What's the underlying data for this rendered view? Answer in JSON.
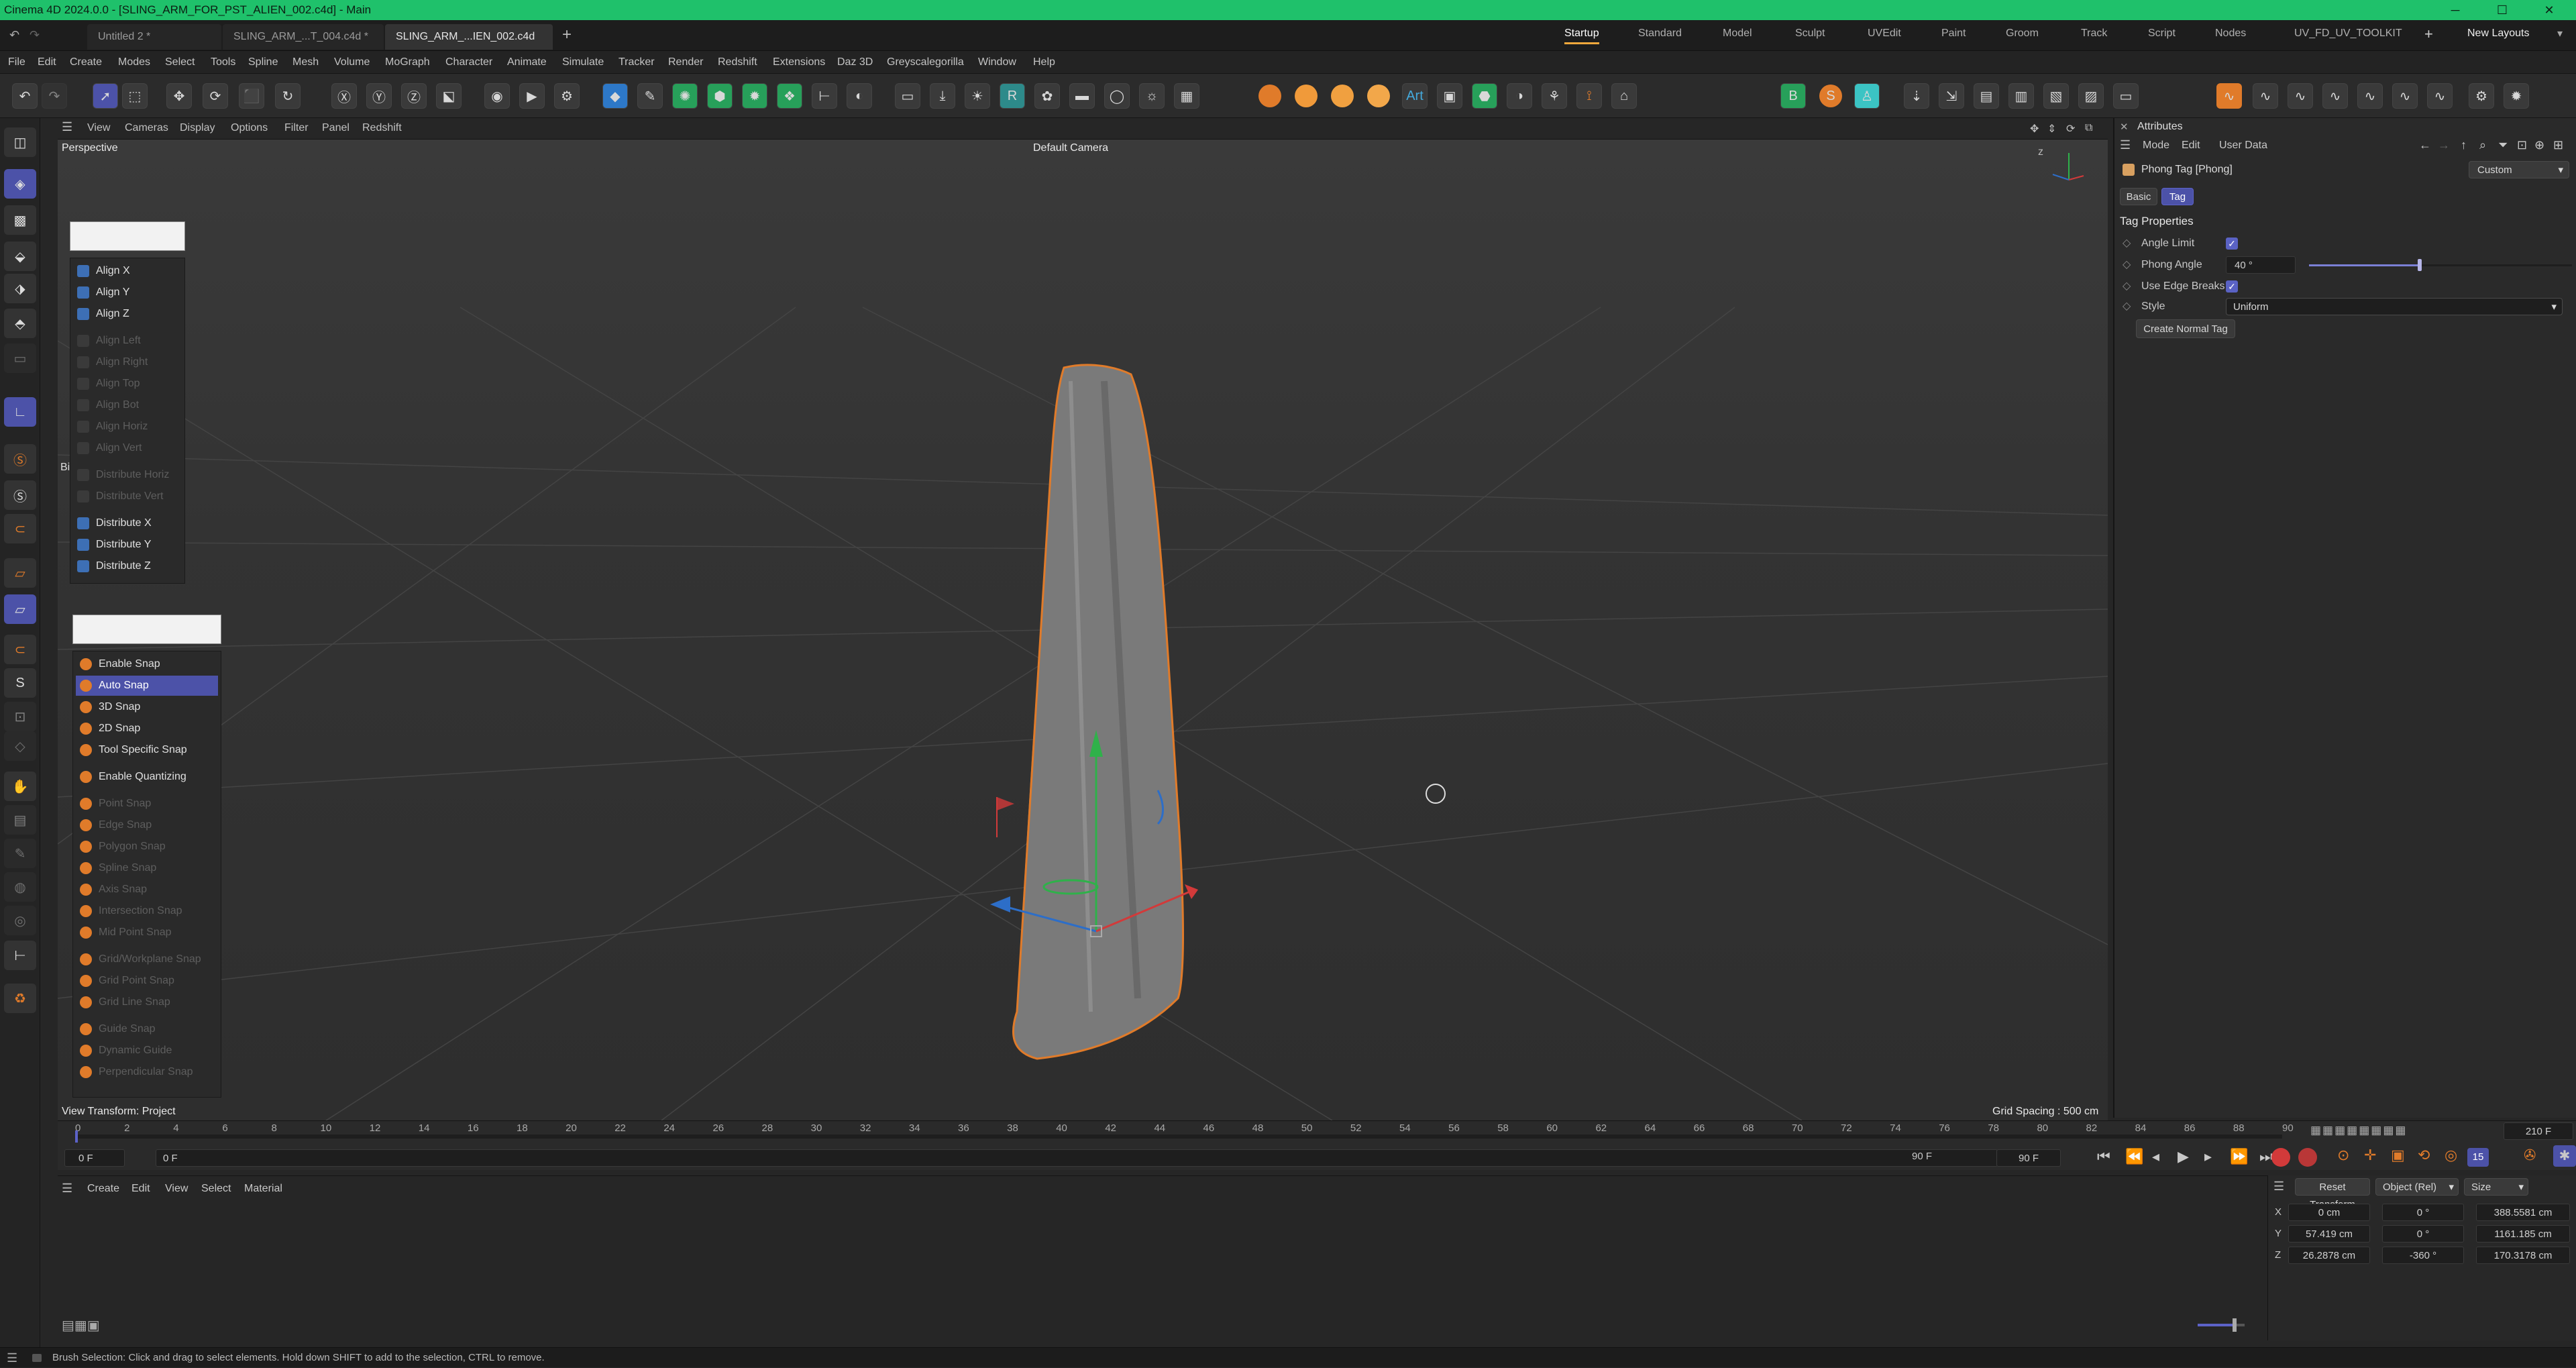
{
  "window": {
    "title": "Cinema 4D 2024.0.0 - [SLING_ARM_FOR_PST_ALIEN_002.c4d] - Main"
  },
  "tabs": [
    {
      "label": "Untitled 2 *"
    },
    {
      "label": "SLING_ARM_...T_004.c4d *"
    },
    {
      "label": "SLING_ARM_...IEN_002.c4d"
    }
  ],
  "layouts": [
    "Startup",
    "Standard",
    "Model",
    "Sculpt",
    "UVEdit",
    "Paint",
    "Groom",
    "Track",
    "Script",
    "Nodes",
    "UV_FD_UV_TOOLKIT"
  ],
  "new_layouts": "New Layouts",
  "menu": [
    "File",
    "Edit",
    "Create",
    "Modes",
    "Select",
    "Tools",
    "Spline",
    "Mesh",
    "Volume",
    "MoGraph",
    "Character",
    "Animate",
    "Simulate",
    "Tracker",
    "Render",
    "Redshift",
    "Extensions",
    "Daz 3D",
    "Greyscalegorilla",
    "Window",
    "Help"
  ],
  "viewport": {
    "menu": [
      "View",
      "Cameras",
      "Display",
      "Options",
      "Filter",
      "Panel",
      "Redshift"
    ],
    "name": "Perspective",
    "camera": "Default Camera",
    "view_transform": "View Transform: Project",
    "grid_spacing": "Grid Spacing : 500 cm",
    "clipped_label": "Bi"
  },
  "align_palette": {
    "items": [
      {
        "label": "Align X",
        "enabled": true
      },
      {
        "label": "Align Y",
        "enabled": true
      },
      {
        "label": "Align Z",
        "enabled": true
      },
      {
        "label": "Align Left",
        "enabled": false
      },
      {
        "label": "Align Right",
        "enabled": false
      },
      {
        "label": "Align Top",
        "enabled": false
      },
      {
        "label": "Align Bot",
        "enabled": false
      },
      {
        "label": "Align Horiz",
        "enabled": false
      },
      {
        "label": "Align Vert",
        "enabled": false
      },
      {
        "label": "Distribute Horiz",
        "enabled": false
      },
      {
        "label": "Distribute Vert",
        "enabled": false
      },
      {
        "label": "Distribute X",
        "enabled": true
      },
      {
        "label": "Distribute Y",
        "enabled": true
      },
      {
        "label": "Distribute Z",
        "enabled": true
      }
    ]
  },
  "snap_palette": {
    "items": [
      {
        "label": "Enable Snap",
        "enabled": true
      },
      {
        "label": "Auto Snap",
        "enabled": true,
        "selected": true
      },
      {
        "label": "3D Snap",
        "enabled": true
      },
      {
        "label": "2D Snap",
        "enabled": true
      },
      {
        "label": "Tool Specific Snap",
        "enabled": true
      },
      {
        "label": "Enable Quantizing",
        "enabled": true
      },
      {
        "label": "Point Snap",
        "enabled": false
      },
      {
        "label": "Edge Snap",
        "enabled": false
      },
      {
        "label": "Polygon Snap",
        "enabled": false
      },
      {
        "label": "Spline Snap",
        "enabled": false
      },
      {
        "label": "Axis Snap",
        "enabled": false
      },
      {
        "label": "Intersection Snap",
        "enabled": false
      },
      {
        "label": "Mid Point Snap",
        "enabled": false
      },
      {
        "label": "Grid/Workplane Snap",
        "enabled": false
      },
      {
        "label": "Grid Point Snap",
        "enabled": false
      },
      {
        "label": "Grid Line Snap",
        "enabled": false
      },
      {
        "label": "Guide Snap",
        "enabled": false
      },
      {
        "label": "Dynamic Guide",
        "enabled": false
      },
      {
        "label": "Perpendicular Snap",
        "enabled": false
      }
    ]
  },
  "attributes": {
    "header": "Attributes",
    "menu": [
      "Mode",
      "Edit",
      "User Data"
    ],
    "object": "Phong Tag [Phong]",
    "preset": "Custom",
    "tabs": [
      "Basic",
      "Tag"
    ],
    "section": "Tag Properties",
    "angle_limit": "Angle Limit",
    "phong_angle": "Phong Angle",
    "phong_angle_value": "40 °",
    "phong_slider": 0.42,
    "use_edge_breaks": "Use Edge Breaks",
    "style": "Style",
    "style_value": "Uniform",
    "create_normal_tag": "Create Normal Tag"
  },
  "timeline": {
    "ticks": [
      "0",
      "2",
      "4",
      "6",
      "8",
      "10",
      "12",
      "14",
      "16",
      "18",
      "20",
      "22",
      "24",
      "26",
      "28",
      "30",
      "32",
      "34",
      "36",
      "38",
      "40",
      "42",
      "44",
      "46",
      "48",
      "50",
      "52",
      "54",
      "56",
      "58",
      "60",
      "62",
      "64",
      "66",
      "68",
      "70",
      "72",
      "74",
      "76",
      "78",
      "80",
      "82",
      "84",
      "86",
      "88",
      "90"
    ],
    "current": "0 F",
    "start": "0 F",
    "end": "90 F",
    "end2": "90 F",
    "total": "210 F",
    "fps": "15"
  },
  "material_menu": [
    "Create",
    "Edit",
    "View",
    "Select",
    "Material"
  ],
  "coords": {
    "reset": "Reset Transform",
    "mode": "Object (Rel)",
    "size_mode": "Size",
    "axes": [
      "X",
      "Y",
      "Z"
    ],
    "pos": [
      "0 cm",
      "57.419 cm",
      "26.2878 cm"
    ],
    "rot": [
      "0 °",
      "0 °",
      "-360 °"
    ],
    "size": [
      "388.5581 cm",
      "1161.185 cm",
      "170.3178 cm"
    ]
  },
  "status": "Brush Selection: Click and drag to select elements. Hold down SHIFT to add to the selection, CTRL to remove."
}
